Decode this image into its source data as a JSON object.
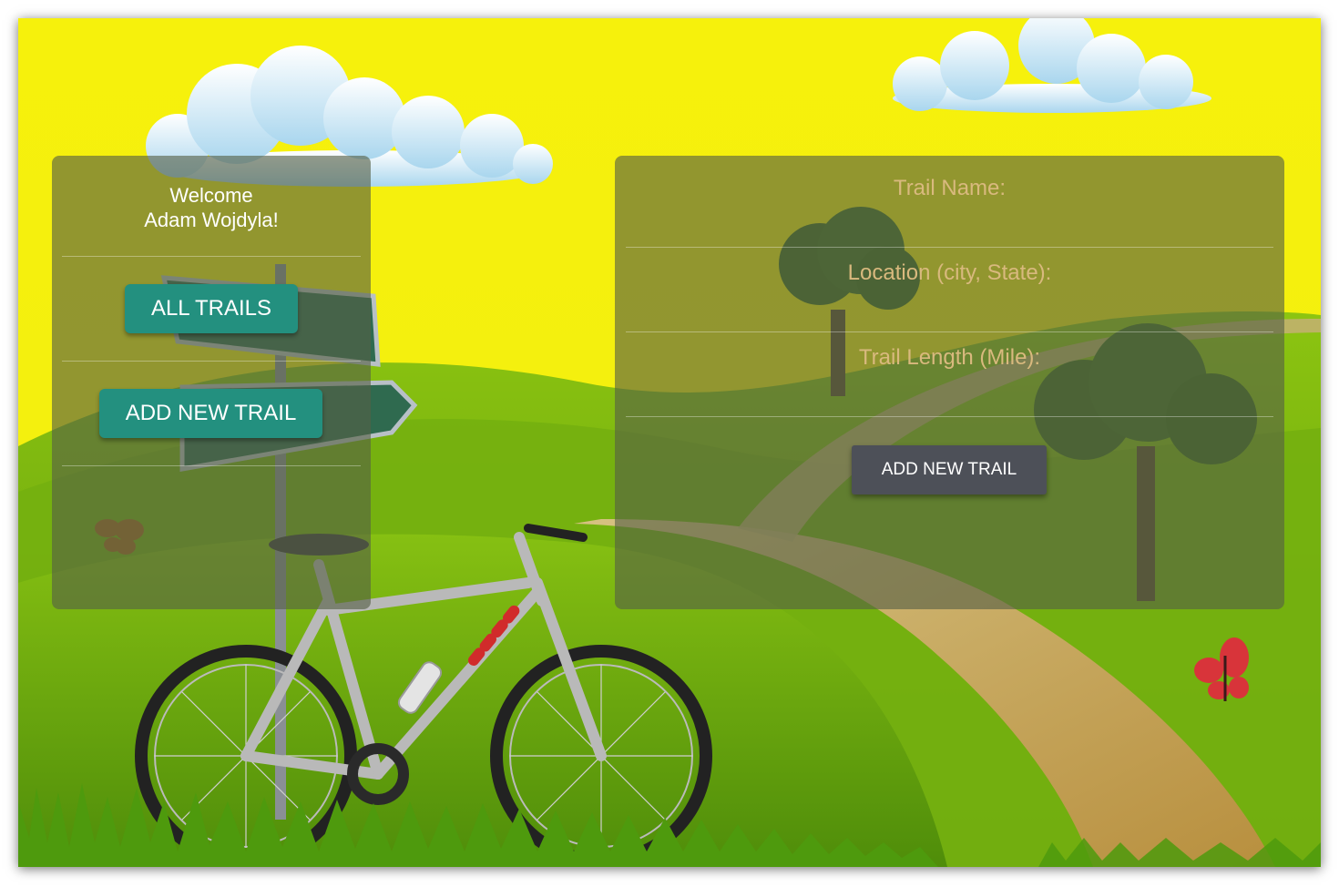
{
  "sidebar": {
    "welcome_line1": "Welcome",
    "welcome_line2": "Adam Wojdyla!",
    "all_trails_label": "ALL TRAILS",
    "add_new_trail_label": "ADD NEW TRAIL"
  },
  "form": {
    "trail_name_label": "Trail Name:",
    "location_label": "Location (city, State):",
    "trail_length_label": "Trail Length (Mile):",
    "trail_name_value": "",
    "location_value": "",
    "trail_length_value": "",
    "submit_label": "ADD NEW TRAIL"
  },
  "colors": {
    "sky": "#f5f00e",
    "hills": "#7bb80e",
    "accent_teal": "#23907f",
    "submit_button": "#4d5058",
    "form_label": "#d9b97e"
  },
  "background_illustration": [
    "sky",
    "clouds",
    "green-hills",
    "dirt-path",
    "trees",
    "signpost",
    "bicycle",
    "butterflies",
    "grass"
  ]
}
